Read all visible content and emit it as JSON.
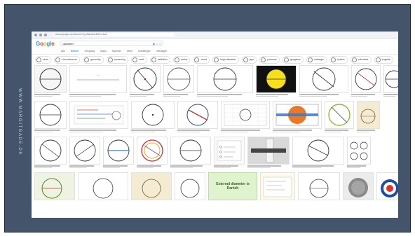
{
  "slide": {
    "side_text": "WWW.MARGITGADE.DK"
  },
  "browser": {
    "url": "www.google.com/search?q=diameter&tbm=isch"
  },
  "google": {
    "logo": [
      "G",
      "o",
      "o",
      "g",
      "l",
      "e"
    ],
    "query": "diameter",
    "tabs": [
      "Alle",
      "Billeder",
      "Shopping",
      "Maps",
      "Nyheder",
      "Mere",
      "Indstillinger",
      "Værktøjer"
    ],
    "active_tab": "Billeder",
    "chips": [
      "circle",
      "circumference",
      "geometry",
      "measuring",
      "math",
      "definition",
      "radius",
      "chord",
      "large diameter",
      "pipe",
      "pressure",
      "geogebra",
      "rectangle",
      "sphere",
      "calculator",
      "engelsk"
    ],
    "featured_card_text": "External diameter is Danish"
  },
  "colors": {
    "slide_bg": "#44546a",
    "side_text": "#c9d2de"
  }
}
